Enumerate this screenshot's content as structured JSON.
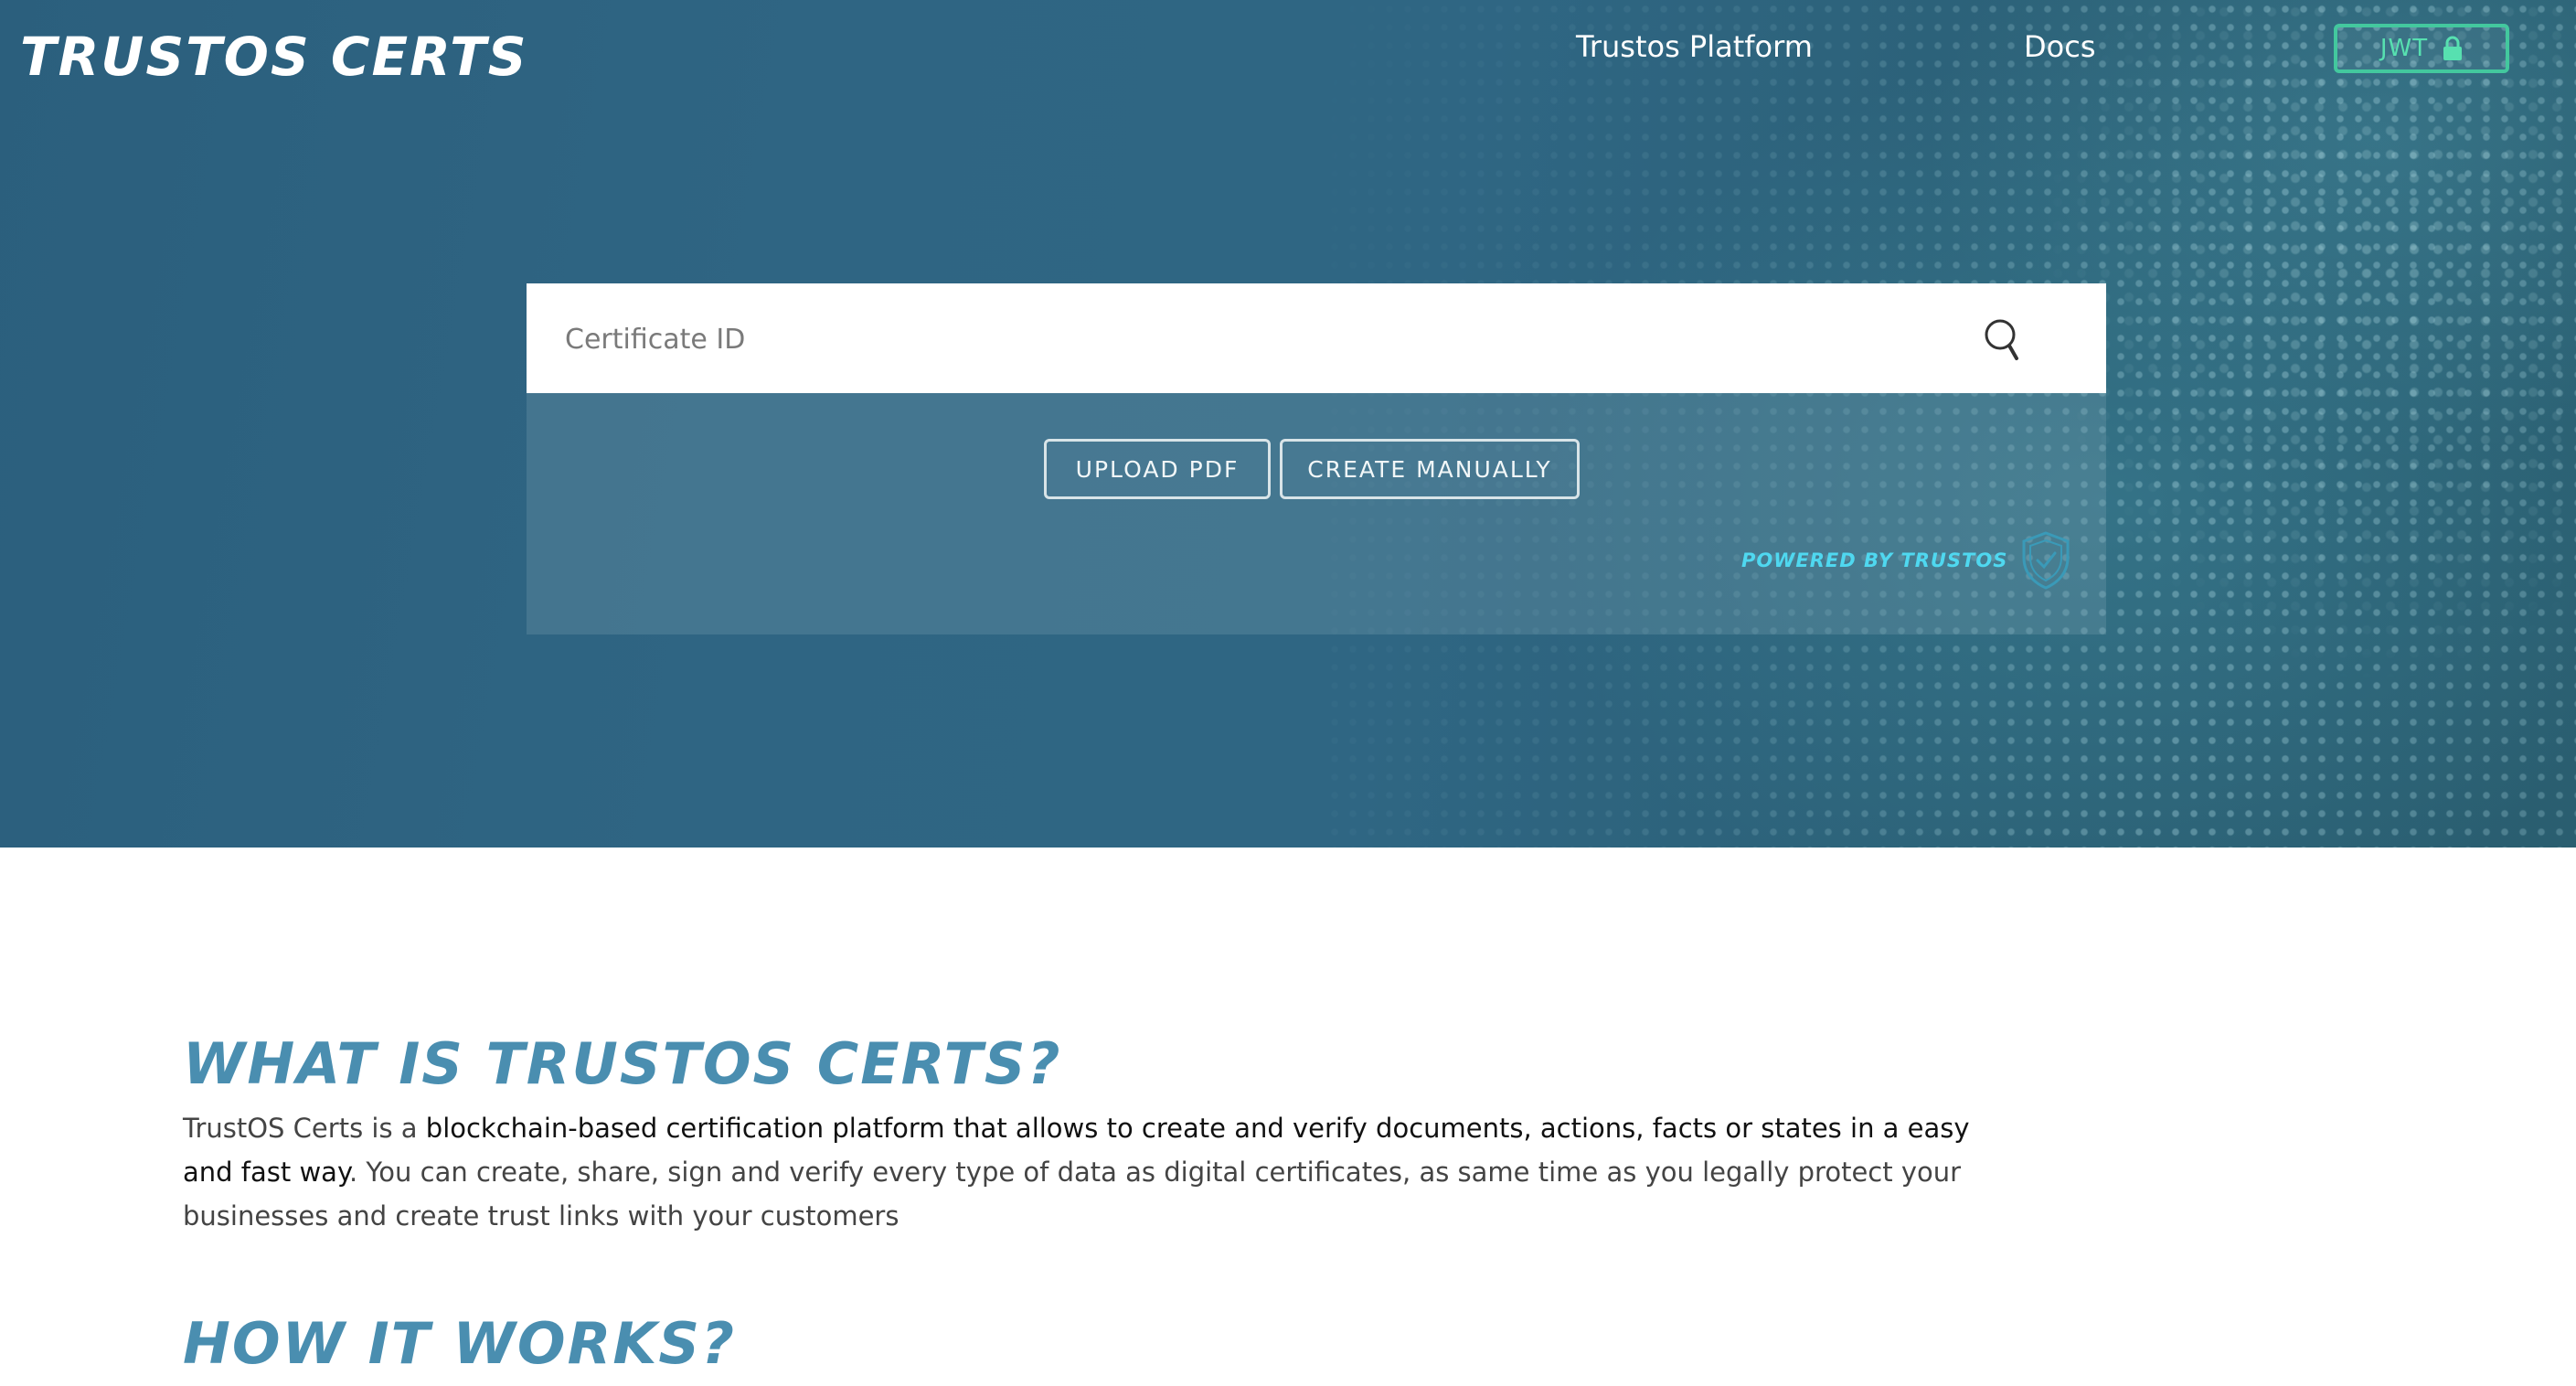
{
  "header": {
    "logo": "TRUSTOS CERTS",
    "nav": [
      {
        "label": "Trustos Platform"
      },
      {
        "label": "Docs"
      }
    ],
    "jwt_button": {
      "label": "JWT",
      "icon": "lock-icon"
    }
  },
  "search": {
    "placeholder": "Certificate ID",
    "value": "",
    "icon": "search-icon"
  },
  "actions": {
    "upload_label": "UPLOAD PDF",
    "create_label": "CREATE MANUALLY"
  },
  "powered_by": {
    "label": "POWERED BY TRUSTOS",
    "icon": "shield-check-icon"
  },
  "about": {
    "title": "WHAT IS TRUSTOS CERTS?",
    "intro": "TrustOS Certs is a ",
    "highlight": "blockchain-based certification platform that allows to create and verify documents, actions, facts or states in a easy and fast way",
    "rest": ". You can create, share, sign and verify every type of data as digital certificates, as same time as you legally protect your businesses and create trust links with your customers"
  },
  "how": {
    "title": "HOW IT WORKS?"
  },
  "colors": {
    "hero_bg": "#2f6583",
    "accent_green": "#43c89e",
    "accent_cyan": "#4fd8f0",
    "section_title": "#4a8eb0"
  }
}
